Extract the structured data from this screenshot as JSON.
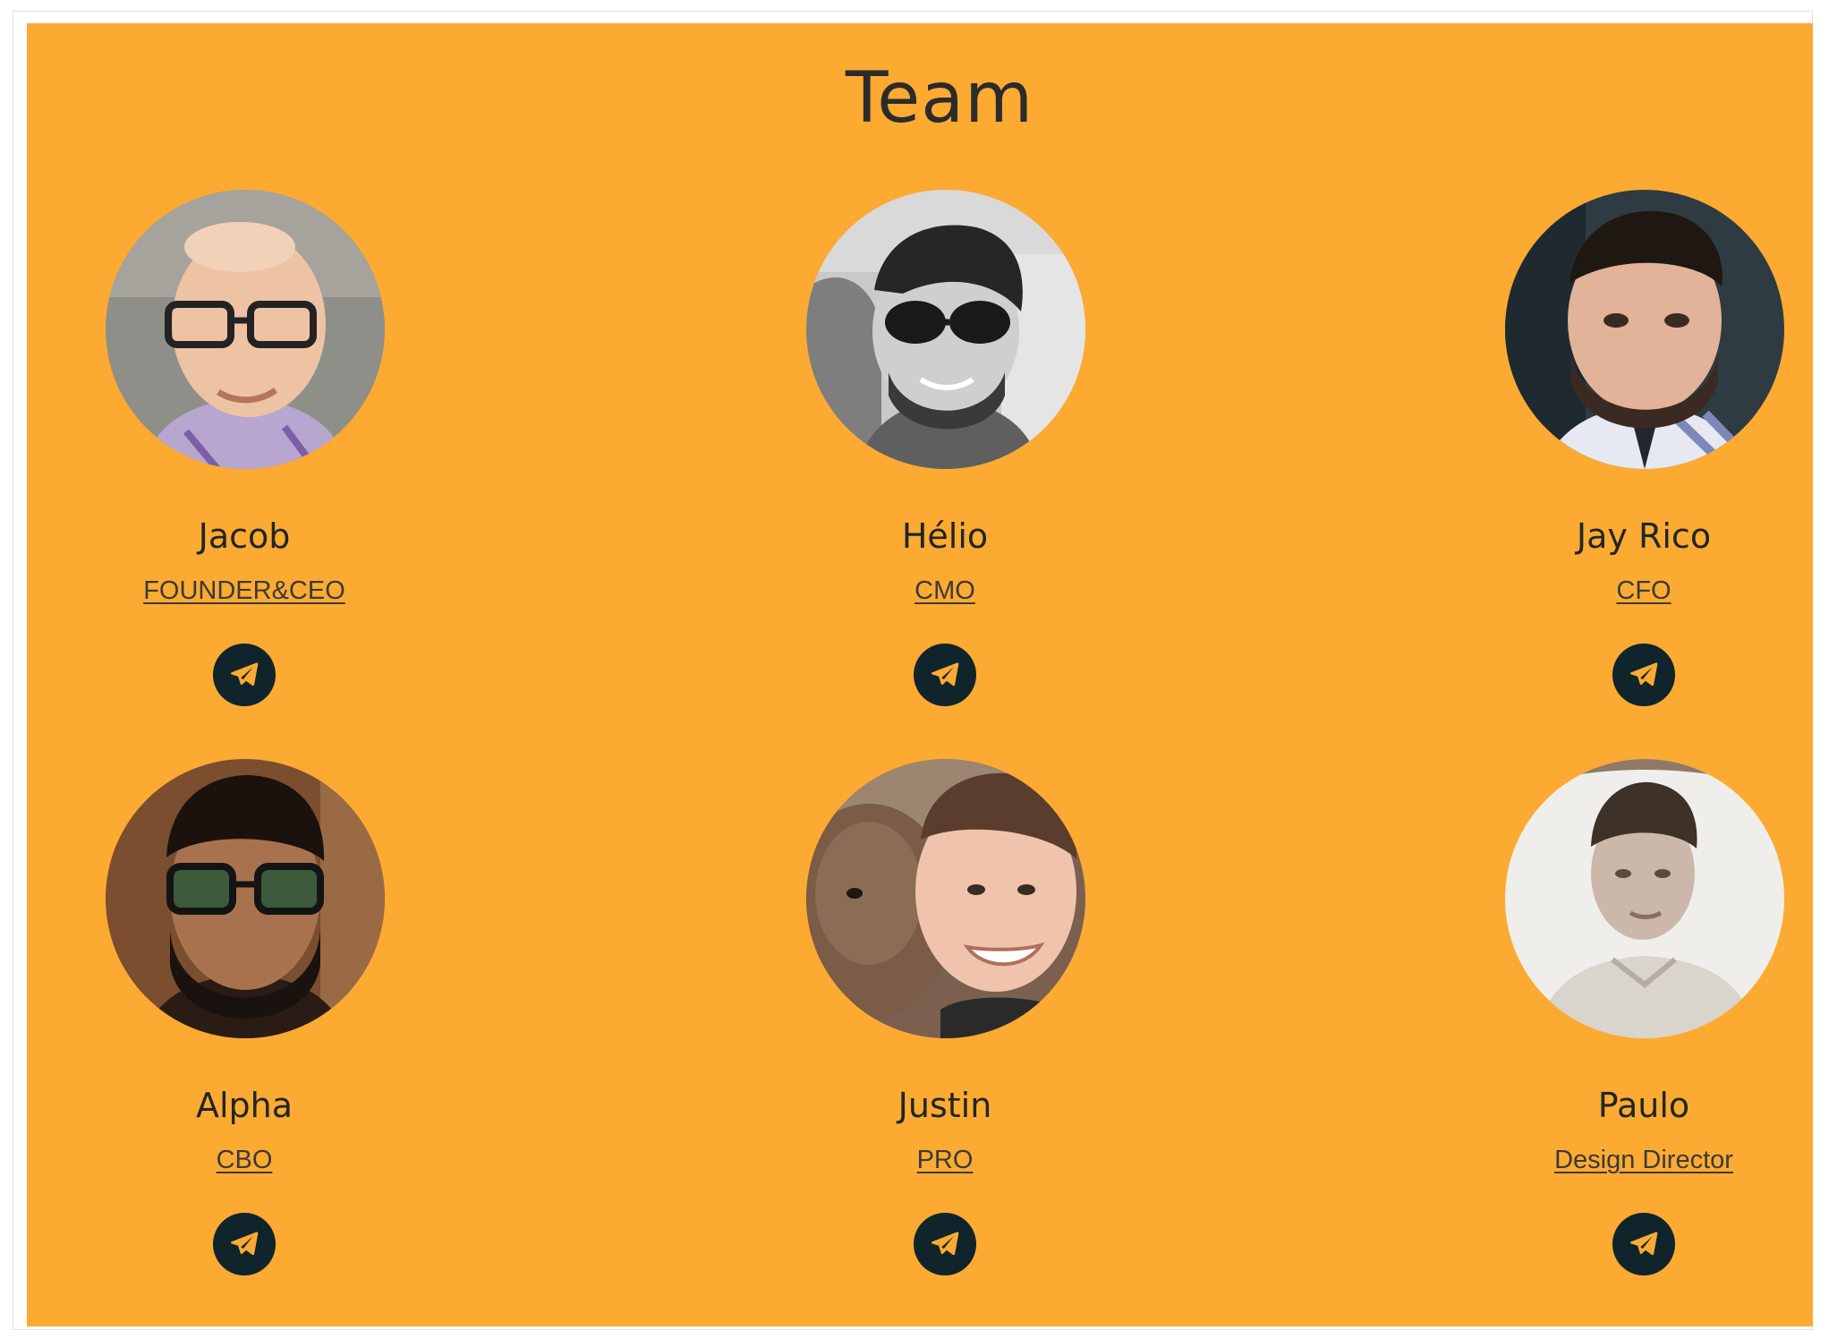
{
  "section": {
    "title": "Team",
    "background": "#fcaa32"
  },
  "colors": {
    "text": "#1f2626",
    "role": "#3a3a3a",
    "icon_bg": "#10242b"
  },
  "members": [
    {
      "name": "Jacob",
      "role": "FOUNDER&CEO",
      "icon": "telegram-icon"
    },
    {
      "name": "Hélio",
      "role": "CMO",
      "icon": "telegram-icon"
    },
    {
      "name": "Jay Rico",
      "role": "CFO",
      "icon": "telegram-icon"
    },
    {
      "name": "Alpha",
      "role": "CBO",
      "icon": "telegram-icon"
    },
    {
      "name": "Justin",
      "role": "PRO",
      "icon": "telegram-icon"
    },
    {
      "name": "Paulo",
      "role": "Design Director",
      "icon": "telegram-icon"
    }
  ]
}
